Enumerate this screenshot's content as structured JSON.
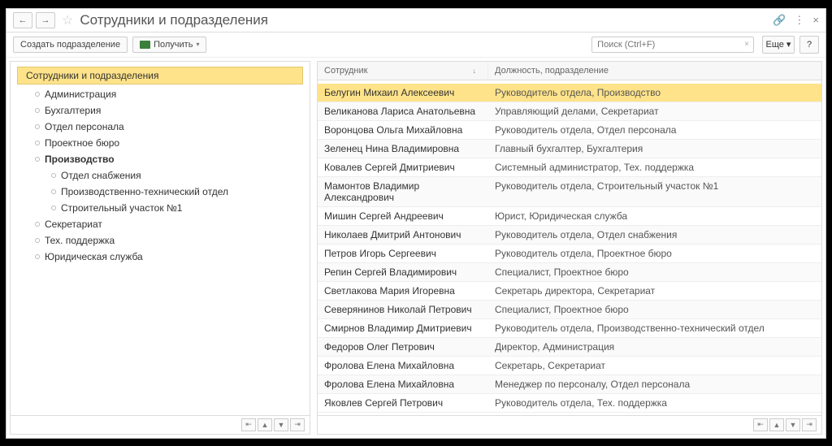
{
  "title": "Сотрудники и подразделения",
  "nav": {
    "back": "←",
    "forward": "→"
  },
  "winControls": {
    "link": "🔗",
    "more": "⋮",
    "close": "×"
  },
  "toolbar": {
    "create_dept": "Создать подразделение",
    "receive": "Получить",
    "search_placeholder": "Поиск (Ctrl+F)",
    "more_btn": "Еще",
    "help": "?"
  },
  "tree": {
    "root": "Сотрудники и подразделения",
    "items": [
      {
        "label": "Администрация"
      },
      {
        "label": "Бухгалтерия"
      },
      {
        "label": "Отдел персонала"
      },
      {
        "label": "Проектное бюро"
      },
      {
        "label": "Производство",
        "bold": true
      },
      {
        "label": "Отдел снабжения",
        "child": true
      },
      {
        "label": "Производственно-технический отдел",
        "child": true
      },
      {
        "label": "Строительный участок №1",
        "child": true
      },
      {
        "label": "Секретариат"
      },
      {
        "label": "Тех. поддержка"
      },
      {
        "label": "Юридическая служба"
      }
    ]
  },
  "grid": {
    "col1": "Сотрудник",
    "col2": "Должность, подразделение",
    "sort": "↓",
    "rows": [
      {
        "name": "Белугин Михаил Алексеевич",
        "pos": "Руководитель отдела, Производство",
        "sel": true
      },
      {
        "name": "Великанова Лариса Анатольевна",
        "pos": "Управляющий делами, Секретариат"
      },
      {
        "name": "Воронцова Ольга Михайловна",
        "pos": "Руководитель отдела, Отдел персонала"
      },
      {
        "name": "Зеленец Нина Владимировна",
        "pos": "Главный бухгалтер, Бухгалтерия"
      },
      {
        "name": "Ковалев Сергей Дмитриевич",
        "pos": "Системный администратор, Тех. поддержка"
      },
      {
        "name": "Мамонтов Владимир Александрович",
        "pos": "Руководитель отдела, Строительный участок №1"
      },
      {
        "name": "Мишин Сергей Андреевич",
        "pos": "Юрист, Юридическая служба"
      },
      {
        "name": "Николаев Дмитрий Антонович",
        "pos": "Руководитель отдела, Отдел снабжения"
      },
      {
        "name": "Петров Игорь Сергеевич",
        "pos": "Руководитель отдела, Проектное бюро"
      },
      {
        "name": "Репин Сергей Владимирович",
        "pos": "Специалист, Проектное бюро"
      },
      {
        "name": "Светлакова Мария Игоревна",
        "pos": "Секретарь директора, Секретариат"
      },
      {
        "name": "Северянинов Николай Петрович",
        "pos": "Специалист, Проектное бюро"
      },
      {
        "name": "Смирнов Владимир Дмитриевич",
        "pos": "Руководитель отдела, Производственно-технический отдел"
      },
      {
        "name": "Федоров Олег Петрович",
        "pos": "Директор, Администрация"
      },
      {
        "name": "Фролова Елена Михайловна",
        "pos": "Секретарь, Секретариат"
      },
      {
        "name": "Фролова Елена Михайловна",
        "pos": "Менеджер по персоналу, Отдел персонала"
      },
      {
        "name": "Яковлев Сергей Петрович",
        "pos": "Руководитель отдела, Тех. поддержка"
      }
    ]
  },
  "footerIcons": [
    "⇤",
    "▲",
    "▼",
    "⇥"
  ]
}
